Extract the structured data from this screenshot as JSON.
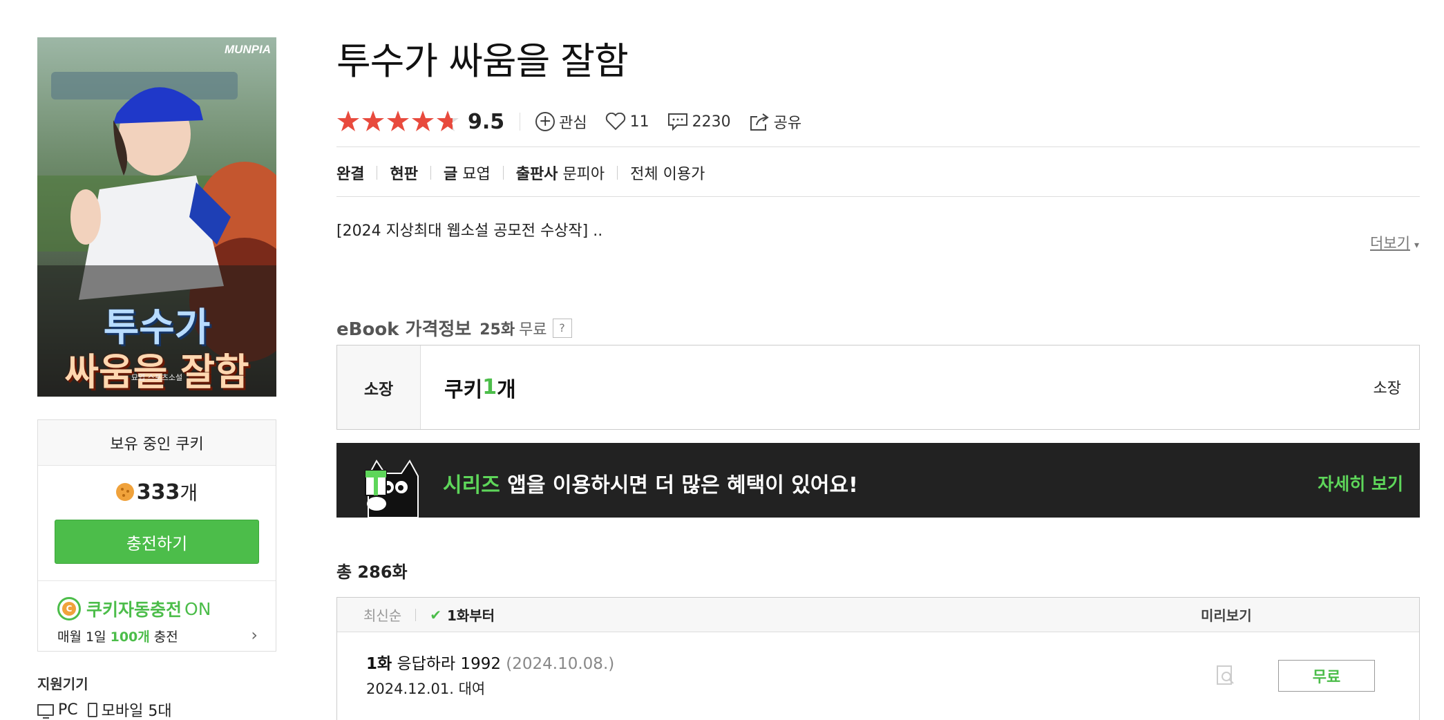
{
  "cover": {
    "publisher_mark": "MUNPIA",
    "title_line1": "투수가",
    "title_line2": "싸움을 잘함",
    "author_caption": "묘엽 스포츠소설"
  },
  "cookie": {
    "header": "보유 중인 쿠키",
    "amount": "333",
    "unit": "개",
    "charge_label": "충전하기",
    "auto_title": "쿠키자동충전",
    "auto_state": "ON",
    "auto_desc_prefix": "매월 1일 ",
    "auto_desc_amount": "100개",
    "auto_desc_suffix": " 충전"
  },
  "devices": {
    "label": "지원기기",
    "pc": "PC",
    "mobile": "모바일 5대"
  },
  "book": {
    "title": "투수가 싸움을 잘함",
    "rating": 9.5,
    "rating_text": "9.5",
    "interest_label": "관심",
    "likes": "11",
    "comments": "2230",
    "share_label": "공유",
    "status": "완결",
    "edition": "현판",
    "writer_label": "글",
    "writer": "묘엽",
    "publisher_label": "출판사",
    "publisher": "문피아",
    "age": "전체 이용가",
    "description": "[2024 지상최대 웹소설 공모전 수상작] ..",
    "more_label": "더보기"
  },
  "pricing": {
    "label": "eBook 가격정보",
    "free_count": "25화",
    "free_label": "무료",
    "help": "?",
    "own_label": "소장",
    "price_prefix": "쿠키 ",
    "price_num": "1",
    "price_unit": "개",
    "own_right": "소장"
  },
  "banner": {
    "brand": "시리즈",
    "text": " 앱을 이용하시면 더 많은 혜택이 있어요!",
    "link": "자세히 보기"
  },
  "episodes": {
    "total": "총 286화",
    "sort_latest": "최신순",
    "sort_first": "1화부터",
    "preview_header": "미리보기",
    "items": [
      {
        "no": "1화",
        "title": " 응답하라 1992",
        "date": " (2024.10.08.)",
        "rental": "2024.12.01. 대여",
        "button": "무료"
      }
    ]
  },
  "colors": {
    "accent_green": "#4cbd4a",
    "star_red": "#e84a3d",
    "banner_bg": "#222222"
  }
}
